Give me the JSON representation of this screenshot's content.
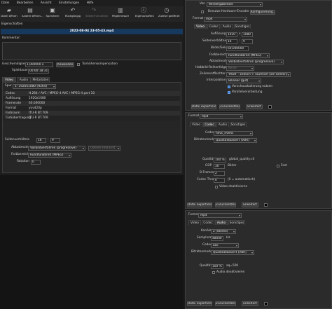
{
  "menu": {
    "items": [
      "Datei",
      "Bearbeiten",
      "Ansicht",
      "Einstellungen",
      "Hilfe"
    ]
  },
  "toolbar": {
    "items": [
      {
        "label": "Datei öffnen",
        "icon": "folder-icon"
      },
      {
        "label": "Andere öffnen…",
        "icon": "open-other-icon"
      },
      {
        "label": "Speichern",
        "icon": "save-icon"
      },
      {
        "label": "Rückgängig",
        "icon": "undo-icon"
      },
      {
        "label": "Wiederherstellen",
        "icon": "redo-icon"
      },
      {
        "label": "Pegelmesser",
        "icon": "meter-icon"
      },
      {
        "label": "Eigenschaften",
        "icon": "properties-icon"
      },
      {
        "label": "Zuletzt geöffnet",
        "icon": "recent-icon"
      }
    ]
  },
  "properties": {
    "dock_title": "Eigenschaften",
    "filename": "2022-08-04 23-05-43.mp4",
    "comment_label": "Kommentar:",
    "speed_label": "Geschwindigkeit",
    "speed_value": "1,000000 x",
    "apply_label": "Anwenden",
    "pitch_label": "Tonhöhenkompensation",
    "duration_label": "Spieldauer",
    "duration_value": "00:00:18:31",
    "tabs": [
      "Video",
      "Audio",
      "Metadaten"
    ],
    "track_label": "Spur",
    "track_value": "1: 1920x1080 (H264)",
    "table": [
      {
        "key": "Codec",
        "value": "H.264 / AVC / MPEG-4 AVC / MPEG-4 part 10"
      },
      {
        "key": "Auflösung",
        "value": "1920x1080"
      },
      {
        "key": "Framerate",
        "value": "60,000000"
      },
      {
        "key": "Format",
        "value": "yuv420p"
      },
      {
        "key": "Farbraum",
        "value": "ITU-R BT.709"
      },
      {
        "key": "Farbübertragung",
        "value": "ITU-R BT.709"
      }
    ],
    "aspect_label": "Seitenverhältnis",
    "aspect_w": "16",
    "aspect_h": "9",
    "scan_label": "Abtastmodus",
    "scan_value": "Vollbildverfahren (progressive)",
    "field_order": "Oberes Feld Erst",
    "range_label": "Farbbereich",
    "range_value": "Rundfunkbreit (MPEG)",
    "rotation_label": "Rotation",
    "rotation_value": "0"
  },
  "export_top": {
    "from_label": "Von",
    "from_value": "Wiedergabeliste",
    "hw_checkbox": "Benutze Hardware-Encoder",
    "config_button": "Konfigurierung…",
    "format_label": "Format",
    "format_value": "mp4",
    "tabs": [
      "Video",
      "Codec",
      "Audio",
      "Sonstiges"
    ],
    "resolution_label": "Auflösung",
    "res_w": "1920",
    "res_x": "x",
    "res_h": "1080",
    "aspect_label": "Seitenverhältnis",
    "aspect_w": "16",
    "aspect_h": "9",
    "fps_label": "Bilder/Sek.",
    "fps_value": "60,000000",
    "range_label": "Farbbereich",
    "range_value": "Rundfunkbreit (MPEG)",
    "scan_label": "Abtastmodus",
    "scan_value": "Vollbildverfahren (progressive)",
    "field_label": "Halbbild-Reihenfolge",
    "field_value": "Keine",
    "deint_label": "Zeilenentflechter",
    "deint_value": "YADIF - zeitlich + räumlich (am besten)",
    "interp_label": "Interpolation",
    "interp_value": "Bilinear (gut)",
    "preview_checkbox": "Vorschauskalierung nutzen",
    "parallel_checkbox": "Parallelverarbeitung",
    "export_button": "Datei exportieren",
    "reset_button": "Zurücksetzen",
    "advanced_button": "Erweitert"
  },
  "export_mid": {
    "format_label": "Format",
    "format_value": "mp4",
    "tabs": [
      "Video",
      "Codec",
      "Audio",
      "Sonstiges"
    ],
    "codec_label": "Codec",
    "codec_value": "hevc_nvenc",
    "rate_label": "Bitratenmodus",
    "rate_value": "Qualitätsbasiert (VBR)",
    "quality_label": "Qualität",
    "quality_value": "100 %",
    "quality_note": "global_quality=0",
    "gop_label": "GOP",
    "gop_value": "30",
    "gop_unit": "Bilder",
    "fixed_label": "Fest",
    "bframes_label": "B-Frames",
    "bframes_value": "2",
    "threads_label": "Codec Threads",
    "threads_value": "0",
    "threads_note": "(0 = automatisch)",
    "disable_video": "Video deaktivieren",
    "export_button": "Datei exportieren",
    "reset_button": "Zurücksetzen",
    "advanced_button": "Erweitert"
  },
  "export_bot": {
    "format_label": "Format",
    "format_value": "mp4",
    "tabs": [
      "Video",
      "Codec",
      "Audio",
      "Sonstiges"
    ],
    "channels_label": "Kanäle",
    "channels_value": "2 (Stereo)",
    "samplerate_label": "Samplerate",
    "samplerate_value": "48000",
    "samplerate_unit": "Hz",
    "codec_label": "Codec",
    "codec_value": "aac",
    "rate_label": "Bitratenmodus",
    "rate_value": "Qualitätsbasiert (VBR)",
    "quality_label": "Qualität",
    "quality_value": "100 %",
    "quality_note": "aq=500",
    "disable_audio": "Audio deaktivieren",
    "export_button": "Datei exportieren",
    "reset_button": "Zurücksetzen",
    "advanced_button": "Erweitert"
  }
}
